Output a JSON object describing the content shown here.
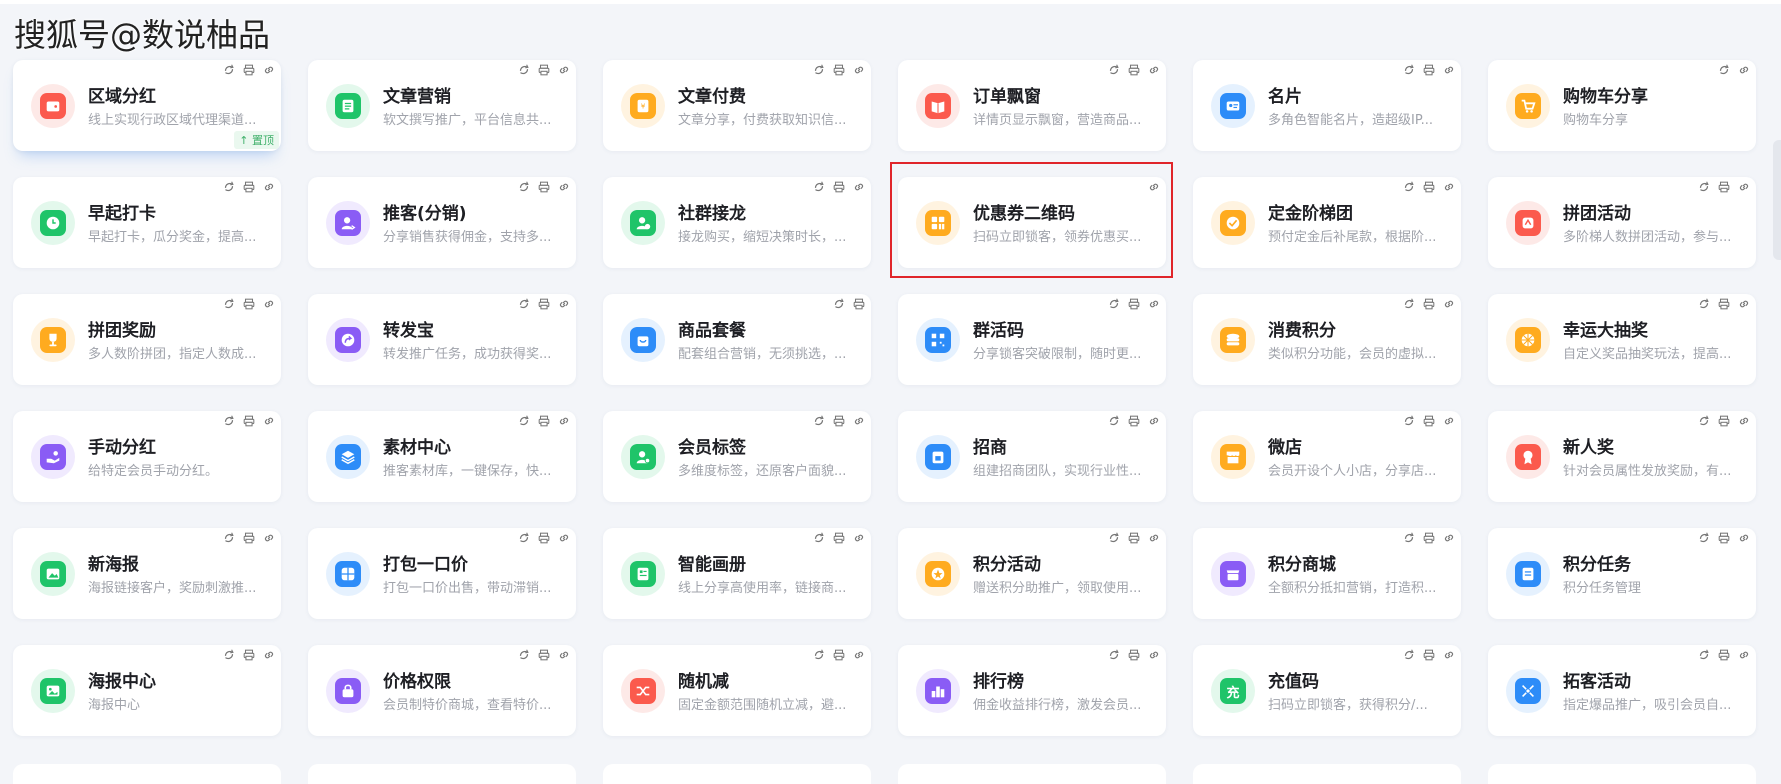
{
  "watermark": "搜狐号@数说柚品",
  "pin_label": "置顶",
  "colors": {
    "red": "#fb5a4d",
    "green": "#1fc469",
    "orange": "#ffab1f",
    "blue": "#2d8cf8",
    "purple": "#8a5cf5",
    "redbg": "#fde9e7",
    "greenbg": "#e3f8ec",
    "orangebg": "#fff3e0",
    "bluebg": "#e5f1fe",
    "purplebg": "#f0eafe",
    "highlight": "#e0252a"
  },
  "cards": [
    {
      "title": "区域分红",
      "desc": "线上实现行政区域代理渠道...",
      "icon": "wallet-icon",
      "color": "red",
      "actions": 3,
      "pinned": true
    },
    {
      "title": "文章营销",
      "desc": "软文撰写推广，平台信息共...",
      "icon": "document-icon",
      "color": "green",
      "actions": 3
    },
    {
      "title": "文章付费",
      "desc": "文章分享，付费获取知识信...",
      "icon": "paid-article-icon",
      "color": "orange",
      "actions": 3
    },
    {
      "title": "订单飘窗",
      "desc": "详情页显示飘窗，营造商品...",
      "icon": "book-icon",
      "color": "red",
      "actions": 3
    },
    {
      "title": "名片",
      "desc": "多角色智能名片，造超级IP...",
      "icon": "id-card-icon",
      "color": "blue",
      "actions": 3
    },
    {
      "title": "购物车分享",
      "desc": "购物车分享",
      "icon": "cart-share-icon",
      "color": "orange",
      "actions": 2
    },
    {
      "title": "早起打卡",
      "desc": "早起打卡，瓜分奖金，提高...",
      "icon": "clock-icon",
      "color": "green",
      "actions": 3
    },
    {
      "title": "推客(分销)",
      "desc": "分享销售获得佣金，支持多...",
      "icon": "user-share-icon",
      "color": "purple",
      "actions": 3
    },
    {
      "title": "社群接龙",
      "desc": "接龙购买，缩短决策时长，...",
      "icon": "group-icon",
      "color": "green",
      "actions": 3
    },
    {
      "title": "优惠券二维码",
      "desc": "扫码立即锁客，领券优惠买...",
      "icon": "coupon-qr-icon",
      "color": "orange",
      "actions": 1,
      "highlighted": true
    },
    {
      "title": "定金阶梯团",
      "desc": "预付定金后补尾款，根据阶...",
      "icon": "deposit-icon",
      "color": "orange",
      "actions": 3
    },
    {
      "title": "拼团活动",
      "desc": "多阶梯人数拼团活动，参与...",
      "icon": "group-buy-icon",
      "color": "red",
      "actions": 3
    },
    {
      "title": "拼团奖励",
      "desc": "多人数阶拼团，指定人数成...",
      "icon": "trophy-icon",
      "color": "orange",
      "actions": 3
    },
    {
      "title": "转发宝",
      "desc": "转发推广任务，成功获得奖...",
      "icon": "forward-icon",
      "color": "purple",
      "actions": 3
    },
    {
      "title": "商品套餐",
      "desc": "配套组合营销，无须挑选，...",
      "icon": "bag-icon",
      "color": "blue",
      "actions": 2
    },
    {
      "title": "群活码",
      "desc": "分享锁客突破限制，随时更...",
      "icon": "qr-code-icon",
      "color": "blue",
      "actions": 3
    },
    {
      "title": "消费积分",
      "desc": "类似积分功能，会员的虚拟...",
      "icon": "coins-icon",
      "color": "orange",
      "actions": 3
    },
    {
      "title": "幸运大抽奖",
      "desc": "自定义奖品抽奖玩法，提高...",
      "icon": "wheel-icon",
      "color": "orange",
      "actions": 3
    },
    {
      "title": "手动分红",
      "desc": "给特定会员手动分红。",
      "icon": "hand-coins-icon",
      "color": "purple",
      "actions": 3
    },
    {
      "title": "素材中心",
      "desc": "推客素材库，一键保存，快...",
      "icon": "layers-icon",
      "color": "blue",
      "actions": 3
    },
    {
      "title": "会员标签",
      "desc": "多维度标签，还原客户面貌...",
      "icon": "member-tag-icon",
      "color": "green",
      "actions": 3
    },
    {
      "title": "招商",
      "desc": "组建招商团队，实现行业性...",
      "icon": "store-icon",
      "color": "blue",
      "actions": 3
    },
    {
      "title": "微店",
      "desc": "会员开设个人小店，分享店...",
      "icon": "shop-icon",
      "color": "orange",
      "actions": 3
    },
    {
      "title": "新人奖",
      "desc": "针对会员属性发放奖励，有...",
      "icon": "medal-icon",
      "color": "red",
      "actions": 3
    },
    {
      "title": "新海报",
      "desc": "海报链接客户，奖励刺激推...",
      "icon": "poster-icon",
      "color": "green",
      "actions": 3
    },
    {
      "title": "打包一口价",
      "desc": "打包一口价出售，带动滞销...",
      "icon": "package-icon",
      "color": "blue",
      "actions": 3
    },
    {
      "title": "智能画册",
      "desc": "线上分享高使用率，链接商...",
      "icon": "album-icon",
      "color": "green",
      "actions": 3
    },
    {
      "title": "积分活动",
      "desc": "赠送积分助推广，领取使用...",
      "icon": "star-coin-icon",
      "color": "orange",
      "actions": 3
    },
    {
      "title": "积分商城",
      "desc": "全额积分抵扣营销，打造积...",
      "icon": "mall-icon",
      "color": "purple",
      "actions": 3
    },
    {
      "title": "积分任务",
      "desc": "积分任务管理",
      "icon": "task-icon",
      "color": "blue",
      "actions": 3
    },
    {
      "title": "海报中心",
      "desc": "海报中心",
      "icon": "image-icon",
      "color": "green",
      "actions": 3
    },
    {
      "title": "价格权限",
      "desc": "会员制特价商城，查看特价...",
      "icon": "lock-bag-icon",
      "color": "purple",
      "actions": 3
    },
    {
      "title": "随机减",
      "desc": "固定金额范围随机立减，避...",
      "icon": "shuffle-icon",
      "color": "red",
      "actions": 3
    },
    {
      "title": "排行榜",
      "desc": "佣金收益排行榜，激发会员...",
      "icon": "ranking-icon",
      "color": "purple",
      "actions": 3
    },
    {
      "title": "充值码",
      "desc": "扫码立即锁客，获得积分/...",
      "icon": "recharge-icon",
      "color": "green",
      "glyph": "充",
      "actions": 3
    },
    {
      "title": "拓客活动",
      "desc": "指定爆品推广，吸引会员自...",
      "icon": "expand-icon",
      "color": "blue",
      "actions": 3
    }
  ]
}
